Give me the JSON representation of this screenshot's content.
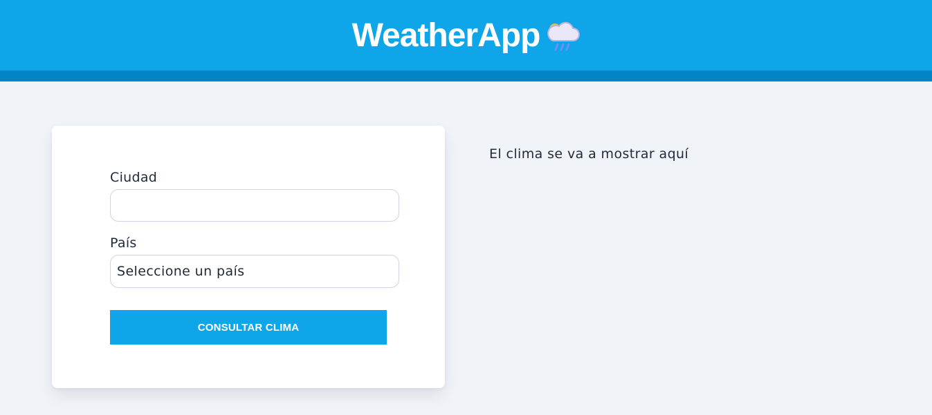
{
  "header": {
    "title": "WeatherApp",
    "icon": "cloud-rain-sun-icon",
    "background_color": "#0ea5e9",
    "bar_color": "#0284c7"
  },
  "form": {
    "city": {
      "label": "Ciudad",
      "value": "",
      "placeholder": ""
    },
    "country": {
      "label": "País",
      "selected": "Seleccione un país"
    },
    "submit_label": "CONSULTAR CLIMA"
  },
  "result": {
    "message": "El clima se va a mostrar aquí"
  }
}
